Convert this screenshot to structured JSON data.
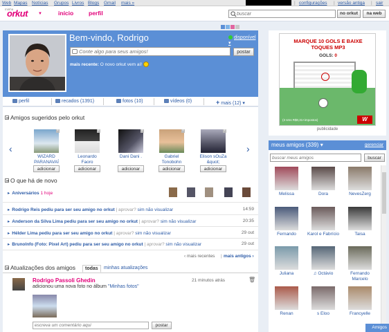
{
  "topbar": {
    "links": [
      "Web",
      "Mapas",
      "Notícias",
      "Grupos",
      "Livros",
      "Blogs",
      "Gmail",
      "mais »"
    ],
    "right_links": [
      "configurações",
      "versão antiga",
      "sair"
    ]
  },
  "header": {
    "logo_small": "minha",
    "logo": "orkut",
    "tabs": [
      "início",
      "perfil"
    ],
    "search_placeholder": "buscar",
    "btn_orkut": "no orkut",
    "btn_web": "na web"
  },
  "profile": {
    "welcome": "Bem-vindo, Rodrigo",
    "status": "disponível",
    "post_placeholder": "Conte algo para seus amigos!",
    "post_button": "postar",
    "recent_label": "mais recente:",
    "recent_text": "O novo orkut vem aí!",
    "theme_colors": [
      "#5b8fd6",
      "#7db3e8",
      "#e066a0",
      "#c8c8c8"
    ]
  },
  "profile_tabs": [
    {
      "label": "perfil"
    },
    {
      "label": "recados (1391)"
    },
    {
      "label": "fotos (10)"
    },
    {
      "label": "vídeos (0)"
    },
    {
      "label": "mais (12)"
    }
  ],
  "suggested": {
    "title": "Amigos sugeridos pelo orkut",
    "add_label": "adicionar",
    "people": [
      {
        "name1": "WIZARD",
        "name2": "PARANAVAÍ"
      },
      {
        "name1": "Leonardo",
        "name2": "Faoro"
      },
      {
        "name1": "Dani Dani .",
        "name2": ""
      },
      {
        "name1": "Gabriel",
        "name2": "Tonobohn"
      },
      {
        "name1": "Elison sOuZa",
        "name2": "&quot;"
      }
    ]
  },
  "news": {
    "title": "O que há de novo",
    "birthdays": "Aniversários",
    "birthdays_today": "1 hoje",
    "action_approve": "aprovar?",
    "action_yes": "sim",
    "action_no": "não",
    "action_view": "visualizar",
    "rows": [
      {
        "text": "Rodrigo Reis pediu para ser seu amigo no orkut",
        "time": "14:59"
      },
      {
        "text": "Anderson da Silva Lima pediu para ser seu amigo no orkut",
        "time": "20:35"
      },
      {
        "text": "Hélder Lima pediu para ser seu amigo no orkut",
        "time": "29 out"
      },
      {
        "text": "Brunolnfo (Foto: Pixel Art) pediu para ser seu amigo no orkut",
        "time": "29 out"
      }
    ],
    "more_recent": "‹ mais recentes",
    "more_old": "mais antigos ›"
  },
  "updates": {
    "title": "Atualizações dos amigos",
    "tab_all": "todas",
    "tab_mine": "minhas atualizações",
    "author": "Rodrigo Passoli Ghedin",
    "action": "adicionou uma nova foto no álbum ",
    "album": "\"Minhas fotos\"",
    "time": "21 minutos atrás",
    "comment_placeholder": "escreva um comentário aqui",
    "comment_button": "postar"
  },
  "ad": {
    "line1": "MARQUE 10 GOLS E BAIXE",
    "line2": "TOQUES MP3",
    "gols_label": "GOLS:",
    "gols_value": "0",
    "footer": "(3 sms R$0,31+impostos)",
    "label": "publicidade"
  },
  "friends": {
    "title": "meus amigos (339)",
    "manage": "gerenciar",
    "search_placeholder": "buscar meus amigos",
    "search_button": "buscar",
    "list": [
      {
        "name": "Melissa",
        "color": "#a04a5a"
      },
      {
        "name": "Dora",
        "color": "#5a4a48"
      },
      {
        "name": "NevesZerg",
        "color": "#8a7a6a"
      },
      {
        "name": "Fernando",
        "color": "#4a5a7a"
      },
      {
        "name": "Karol e Fabrício",
        "color": "#6a5a5a"
      },
      {
        "name": "Taisa",
        "color": "#3a3a3a"
      },
      {
        "name": "Juliana",
        "color": "#7a9aaa"
      },
      {
        "name": "♫ Octávio",
        "color": "#556677"
      },
      {
        "name": "Fernando Marcelo",
        "color": "#6a6a5a"
      },
      {
        "name": "Renan",
        "color": "#aa5a4a"
      },
      {
        "name": "s Eloo",
        "color": "#7a6a6a"
      },
      {
        "name": "Francyelle",
        "color": "#aa8a6a"
      }
    ],
    "chat_bar": "Amigos"
  }
}
